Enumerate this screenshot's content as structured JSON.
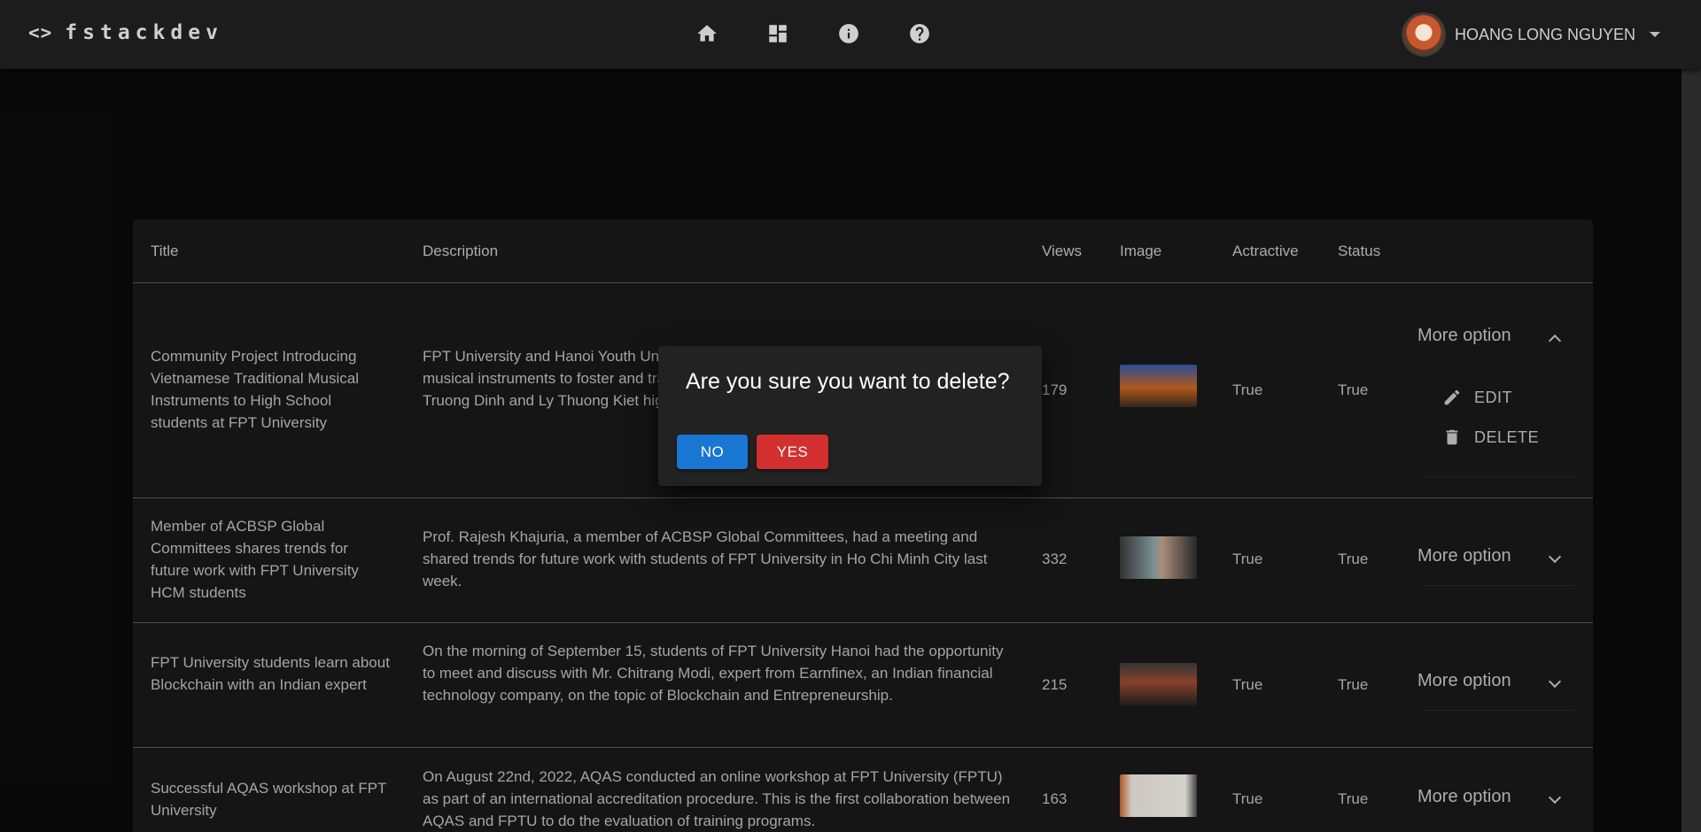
{
  "app": {
    "brand": "fstackdev",
    "nav_icons": [
      "home-icon",
      "dashboard-icon",
      "info-icon",
      "help-icon"
    ],
    "user_name": "HOANG LONG NGUYEN"
  },
  "table": {
    "headers": [
      "Title",
      "Description",
      "Views",
      "Image",
      "Actractive",
      "Status"
    ],
    "rows": [
      {
        "title": "Community Project Introducing Vietnamese Traditional Musical Instruments to High School students at FPT University",
        "description": "FPT University and Hanoi Youth Union have been introducing Vietnamese traditional musical instruments to foster and transmit traditional values, which were introduced at Truong Dinh and Ly Thuong Kiet high schools.",
        "views": "179",
        "attractive": "True",
        "status": "True",
        "more": "More option",
        "expanded": true
      },
      {
        "title": "Member of ACBSP Global Committees shares trends for future work with FPT University HCM students",
        "description": "Prof. Rajesh Khajuria, a member of ACBSP Global Committees, had a meeting and shared trends for future work with students of FPT University in Ho Chi Minh City last week.",
        "views": "332",
        "attractive": "True",
        "status": "True",
        "more": "More option",
        "expanded": false
      },
      {
        "title": "FPT University students learn about Blockchain with an Indian expert",
        "description": "On the morning of September 15, students of FPT University Hanoi had the opportunity to meet and discuss with Mr. Chitrang Modi, expert from Earnfinex, an Indian financial technology company, on the topic of Blockchain and Entrepreneurship.",
        "views": "215",
        "attractive": "True",
        "status": "True",
        "more": "More option",
        "expanded": false
      },
      {
        "title": "Successful AQAS workshop at FPT University",
        "description": "On August 22nd, 2022, AQAS conducted an online workshop at FPT University (FPTU) as part of an international accreditation procedure. This is the first collaboration between AQAS and FPTU to do the evaluation of training programs.",
        "views": "163",
        "attractive": "True",
        "status": "True",
        "more": "More option",
        "expanded": false
      }
    ],
    "menu": {
      "edit": "EDIT",
      "delete": "DELETE"
    }
  },
  "dialog": {
    "question": "Are you sure you want to delete?",
    "no": "NO",
    "yes": "YES",
    "no_color": "#1976d2",
    "yes_color": "#d32f2f"
  }
}
